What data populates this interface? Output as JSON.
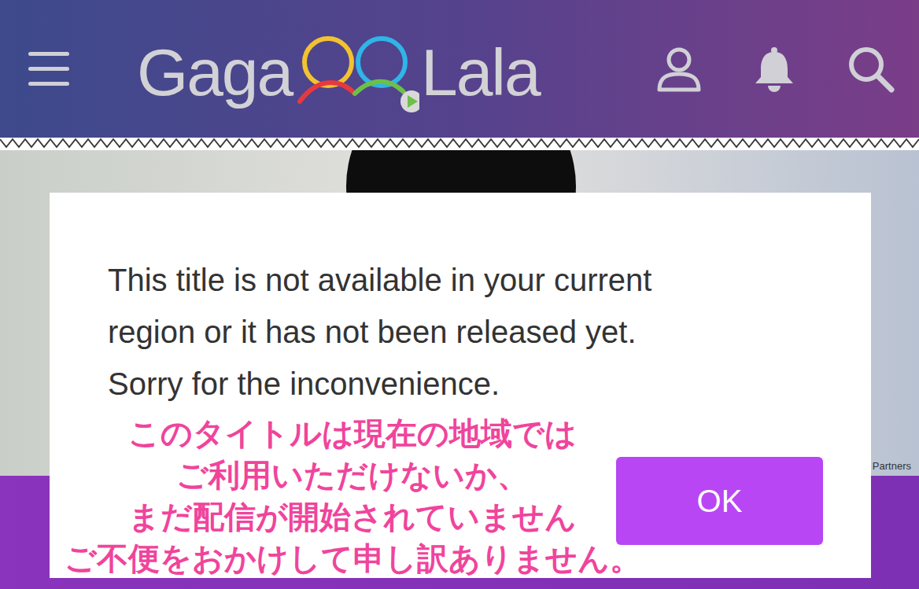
{
  "header": {
    "logo": [
      "Gaga",
      "Lala"
    ]
  },
  "banner": {
    "caption": "Partners"
  },
  "dialog": {
    "message": [
      "This title is not available in your current",
      "region or it has not been released yet.",
      "Sorry for the inconvenience."
    ],
    "translation": [
      "このタイトルは現在の地域では",
      "ご利用いただけないか、",
      "まだ配信が開始されていません",
      "ご不便をおかけして申し訳ありません。"
    ],
    "button": "OK"
  }
}
